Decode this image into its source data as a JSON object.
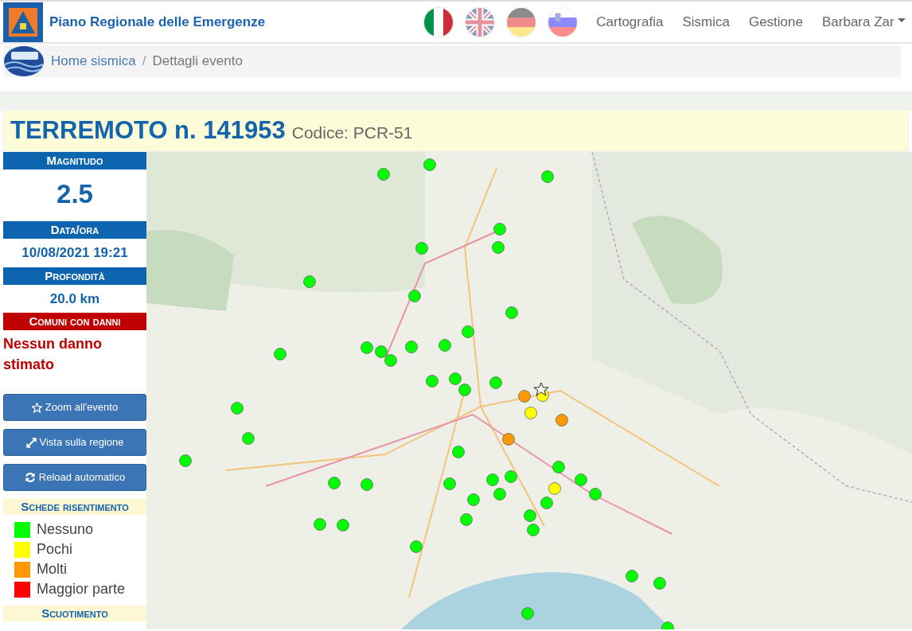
{
  "brand": {
    "title": "Piano Regionale delle Emergenze"
  },
  "languages": [
    {
      "kind": "it",
      "selected": true
    },
    {
      "kind": "gb",
      "selected": false
    },
    {
      "kind": "de",
      "selected": false
    },
    {
      "kind": "si",
      "selected": false
    }
  ],
  "nav": [
    {
      "label": "Cartografia",
      "dropdown": false
    },
    {
      "label": "Sismica",
      "dropdown": false
    },
    {
      "label": "Gestione",
      "dropdown": false
    },
    {
      "label": "Barbara Zar",
      "dropdown": true
    }
  ],
  "breadcrumb": [
    {
      "label": "Home sismica",
      "active": false
    },
    {
      "label": "Dettagli evento",
      "active": true
    }
  ],
  "breadcrumb_separator": "/",
  "event": {
    "title": "TERREMOTO n. 141953",
    "code": "Codice: PCR-51"
  },
  "info": [
    {
      "heading": "Magnitudo",
      "value": "2.5",
      "kind": "big"
    },
    {
      "heading": "Data/ora",
      "value": "10/08/2021 19:21",
      "kind": "normal"
    },
    {
      "heading": "Profondità",
      "value": "20.0 km",
      "kind": "normal"
    },
    {
      "heading": "Comuni con danni",
      "value": "Nessun danno stimato",
      "kind": "alert"
    }
  ],
  "buttons": [
    {
      "label": "Zoom all'evento",
      "kind": "star"
    },
    {
      "label": "Vista sulla regione",
      "kind": "expand"
    },
    {
      "label": "Reload automatico",
      "kind": "reload"
    }
  ],
  "legend": {
    "heading": "Schede risentimento",
    "items": [
      {
        "label": "Nessuno",
        "color": "#00ff00"
      },
      {
        "label": "Pochi",
        "color": "#ffff00"
      },
      {
        "label": "Molti",
        "color": "#ff9900"
      },
      {
        "label": "Maggior parte",
        "color": "#ff0000"
      }
    ]
  },
  "shaking": {
    "heading": "Scuotimento"
  }
}
